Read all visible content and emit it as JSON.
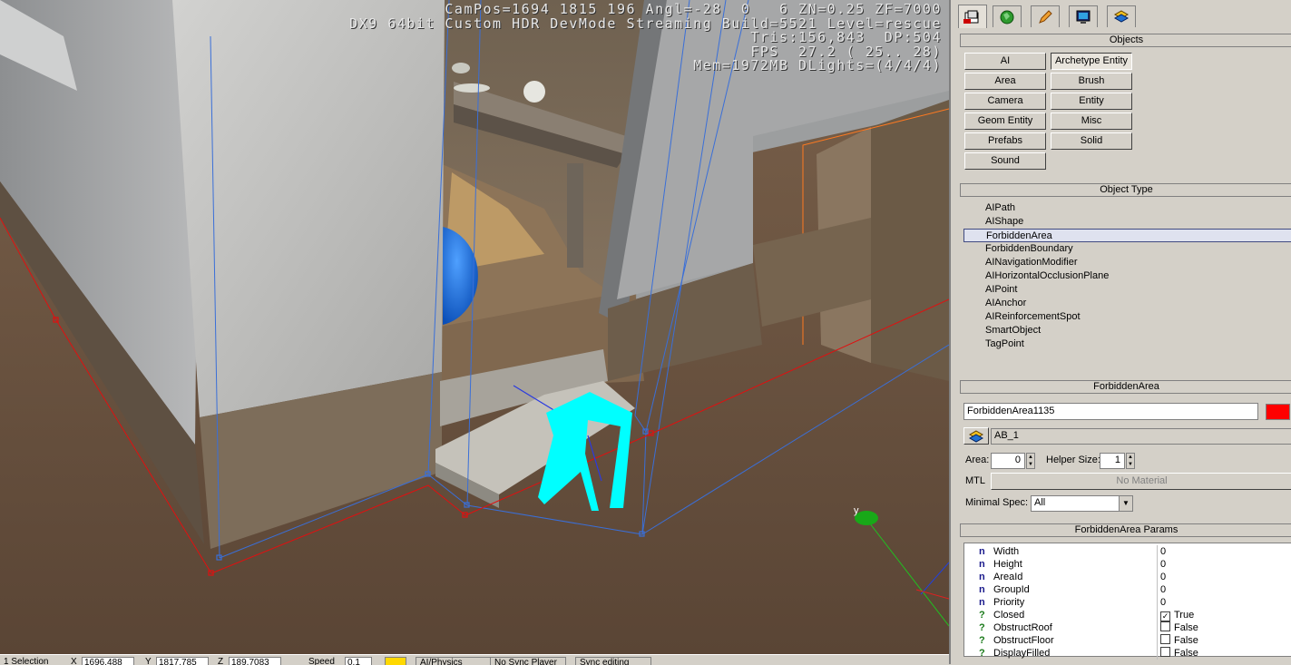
{
  "hud": {
    "line1": "CamPos=1694 1815 196 Angl=-28  0   6 ZN=0.25 ZF=7000",
    "line2": "DX9 64bit Custom HDR DevMode Streaming Build=5521 Level=rescue",
    "line3": "Tris:156,843  DP:504",
    "line4": "FPS  27.2 ( 25.. 28)",
    "line5": "Mem=1972MB DLights=(4/4/4)"
  },
  "viewport_axis_label": "y",
  "statusbar": {
    "selection": "1 Selection",
    "x_label": "X",
    "x_value": "1696.488",
    "y_label": "Y",
    "y_value": "1817.785",
    "z_label": "Z",
    "z_value": "189.7083",
    "speed_label": "Speed",
    "speed_value": "0.1",
    "ai_physics": "AI/Physics",
    "no_sync_player": "No Sync Player",
    "sync_editing": "Sync editing"
  },
  "tabs": [
    {
      "icon": "create-objects-icon"
    },
    {
      "icon": "terrain-globe-icon"
    },
    {
      "icon": "pencil-icon"
    },
    {
      "icon": "display-monitor-icon"
    },
    {
      "icon": "layers-icon"
    }
  ],
  "objects": {
    "header": "Objects",
    "buttons_left": [
      "AI",
      "Area",
      "Camera",
      "Geom Entity",
      "Prefabs",
      "Sound"
    ],
    "buttons_right": [
      "Archetype Entity",
      "Brush",
      "Entity",
      "Misc",
      "Solid"
    ]
  },
  "object_type": {
    "header": "Object Type",
    "items": [
      "AIPath",
      "AIShape",
      "ForbiddenArea",
      "ForbiddenBoundary",
      "AINavigationModifier",
      "AIHorizontalOcclusionPlane",
      "AIPoint",
      "AIAnchor",
      "AIReinforcementSpot",
      "SmartObject",
      "TagPoint"
    ],
    "selected": "ForbiddenArea"
  },
  "forbidden_area": {
    "header": "ForbiddenArea",
    "name": "ForbiddenArea1135",
    "color": "#ff0000",
    "layer": "AB_1",
    "area_label": "Area:",
    "area_value": "0",
    "helper_size_label": "Helper Size:",
    "helper_size_value": "1",
    "mtl_label": "MTL",
    "mtl_button": "No Material",
    "minimal_spec_label": "Minimal Spec:",
    "minimal_spec_value": "All"
  },
  "params": {
    "header": "ForbiddenArea Params",
    "rows": [
      {
        "type": "n",
        "name": "Width",
        "value": "0"
      },
      {
        "type": "n",
        "name": "Height",
        "value": "0"
      },
      {
        "type": "n",
        "name": "AreaId",
        "value": "0"
      },
      {
        "type": "n",
        "name": "GroupId",
        "value": "0"
      },
      {
        "type": "n",
        "name": "Priority",
        "value": "0"
      },
      {
        "type": "?",
        "name": "Closed",
        "value": "True",
        "checked": true
      },
      {
        "type": "?",
        "name": "ObstructRoof",
        "value": "False",
        "checked": false
      },
      {
        "type": "?",
        "name": "ObstructFloor",
        "value": "False",
        "checked": false
      },
      {
        "type": "?",
        "name": "DisplayFilled",
        "value": "False",
        "checked": false
      }
    ]
  },
  "colors": {
    "panel_bg": "#d4d0c8",
    "selection_border": "#404a80",
    "forbidden_area_outline": "#e01010",
    "shape_helper": "#3a6fd8",
    "gizmo_cyan": "#00ffff"
  }
}
